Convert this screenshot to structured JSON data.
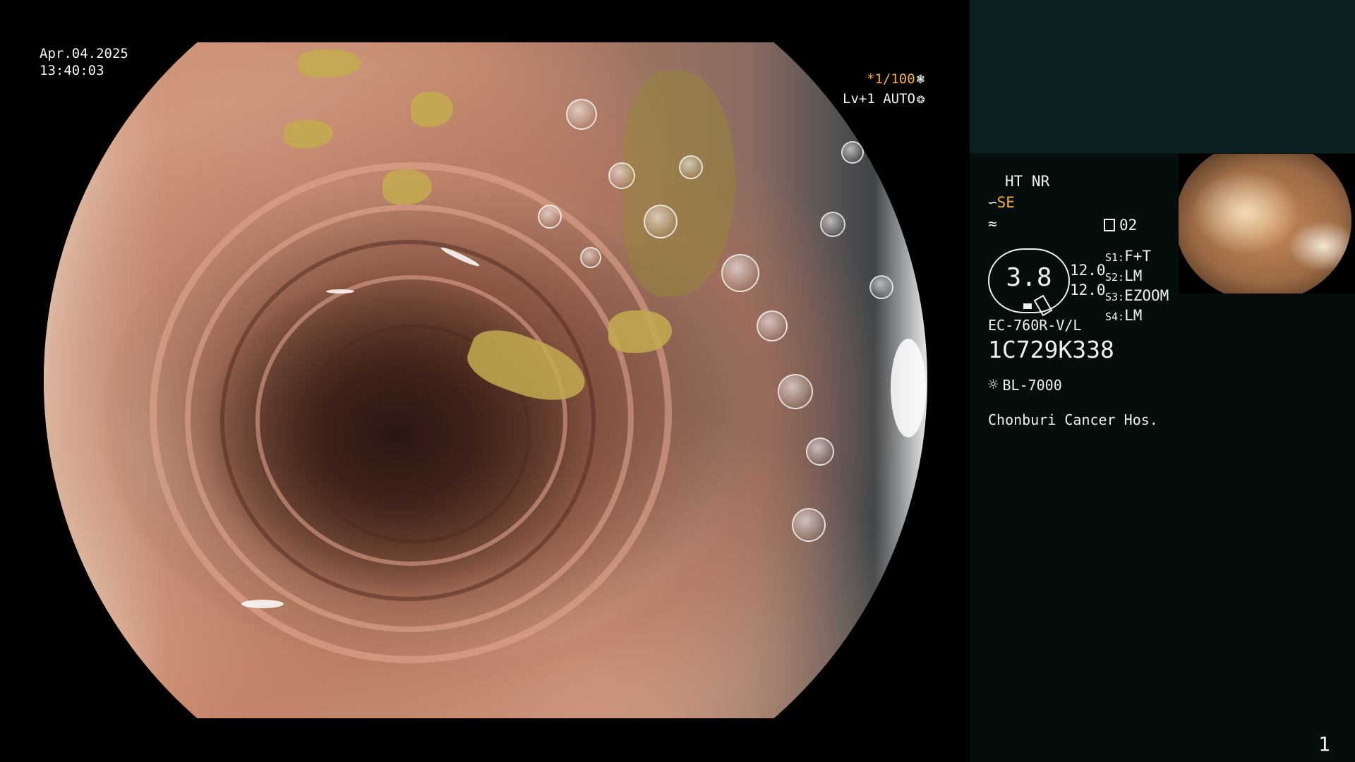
{
  "overlay": {
    "date": "Apr.04.2025",
    "time": "13:40:03",
    "shutter": "*1/100",
    "shutter_icon": "shutter-icon",
    "level": "Lv+1 AUTO",
    "auto_icon": "auto-iris-icon"
  },
  "panel": {
    "mode": "HT NR",
    "se_label": "SE",
    "structure_icon": "structure-enhance-icon",
    "color_icon": "color-enhance-icon",
    "channel_icon": "memory-card-icon",
    "channel": "02",
    "magnification": "3.8",
    "values": [
      "12.0",
      "12.0"
    ],
    "switches": [
      {
        "key": "S1:",
        "value": "F+T"
      },
      {
        "key": "S2:",
        "value": "LM"
      },
      {
        "key": "S3:",
        "value": "EZOOM"
      },
      {
        "key": "S4:",
        "value": "LM"
      }
    ],
    "scope_model": "EC-760R-V/L",
    "serial": "1C729K338",
    "light_icon": "light-source-icon",
    "light_source": "BL-7000",
    "institution": "Chonburi Cancer Hos."
  },
  "page_number": "1",
  "colors": {
    "accent_amber": "#f5b23a",
    "panel_bg": "#060d0d",
    "panel_band": "#0c2222"
  }
}
